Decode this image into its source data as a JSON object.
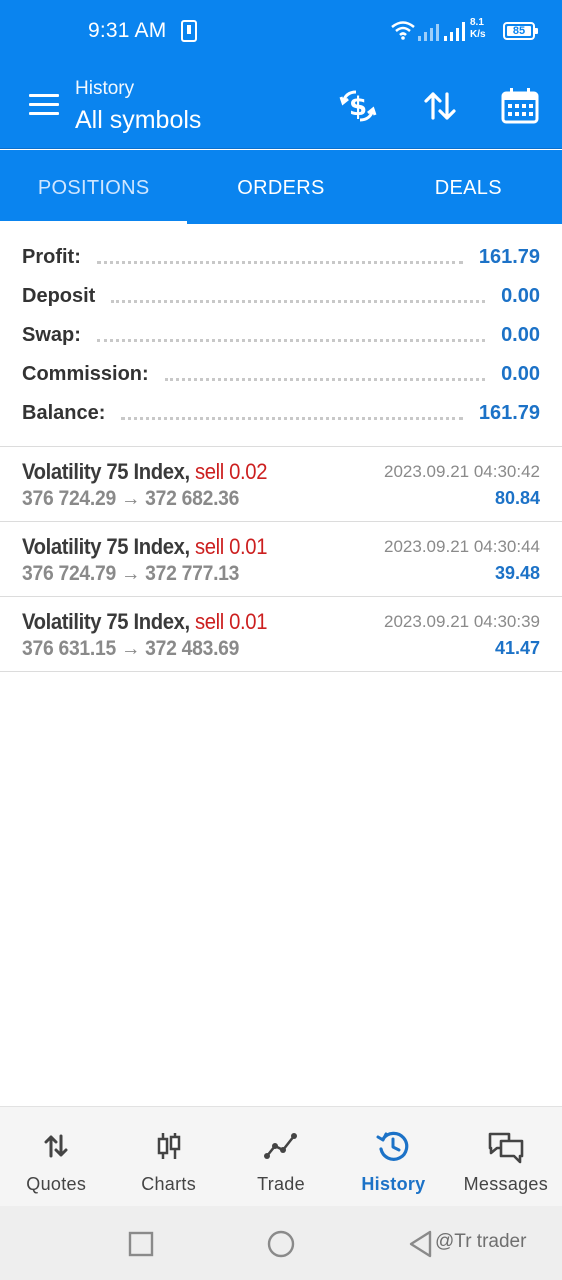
{
  "status_bar": {
    "time": "9:31 AM",
    "net_speed_value": "8.1",
    "net_speed_unit": "K/s",
    "battery": "85",
    "icons": [
      "phone-icon",
      "wifi-icon",
      "signal-icon",
      "battery-icon"
    ]
  },
  "app_bar": {
    "subtitle": "History",
    "title": "All symbols",
    "icons": [
      "menu-icon",
      "currency-exchange-icon",
      "sort-icon",
      "calendar-icon"
    ]
  },
  "tabs": [
    {
      "label": "POSITIONS",
      "active": true
    },
    {
      "label": "ORDERS",
      "active": false
    },
    {
      "label": "DEALS",
      "active": false
    }
  ],
  "summary": [
    {
      "label": "Profit:",
      "value": "161.79"
    },
    {
      "label": "Deposit",
      "value": "0.00"
    },
    {
      "label": "Swap:",
      "value": "0.00"
    },
    {
      "label": "Commission:",
      "value": "0.00"
    },
    {
      "label": "Balance:",
      "value": "161.79"
    }
  ],
  "deals": [
    {
      "symbol": "Volatility 75 Index,",
      "side": "sell 0.02",
      "prices": "376 724.29 → 372 682.36",
      "time": "2023.09.21 04:30:42",
      "profit": "80.84"
    },
    {
      "symbol": "Volatility 75 Index,",
      "side": "sell 0.01",
      "prices": "376 724.79 → 372 777.13",
      "time": "2023.09.21 04:30:44",
      "profit": "39.48"
    },
    {
      "symbol": "Volatility 75 Index,",
      "side": "sell 0.01",
      "prices": "376 631.15 → 372 483.69",
      "time": "2023.09.21 04:30:39",
      "profit": "41.47"
    }
  ],
  "bottom_nav": [
    {
      "label": "Quotes",
      "icon": "quotes-icon",
      "active": false
    },
    {
      "label": "Charts",
      "icon": "charts-icon",
      "active": false
    },
    {
      "label": "Trade",
      "icon": "trade-icon",
      "active": false
    },
    {
      "label": "History",
      "icon": "history-icon",
      "active": true
    },
    {
      "label": "Messages",
      "icon": "messages-icon",
      "active": false
    }
  ],
  "system_bar": {
    "watermark": "@Tr trader"
  },
  "colors": {
    "primary": "#0a84ef",
    "value_blue": "#1c72c7",
    "sell_red": "#cc1f1f"
  }
}
